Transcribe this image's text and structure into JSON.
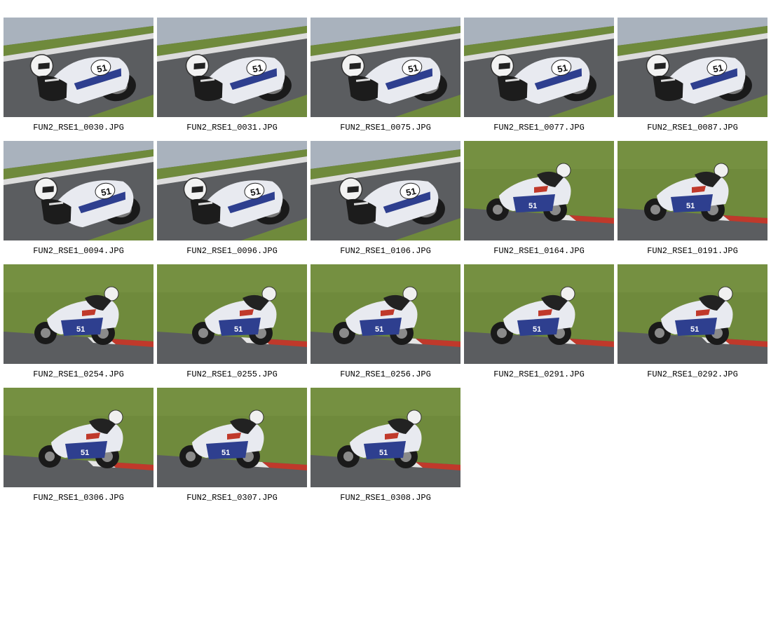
{
  "gallery": {
    "items": [
      {
        "filename": "FUN2_RSE1_0030.JPG",
        "scene": "curve-closeup",
        "number": "51"
      },
      {
        "filename": "FUN2_RSE1_0031.JPG",
        "scene": "curve-closeup",
        "number": "51"
      },
      {
        "filename": "FUN2_RSE1_0075.JPG",
        "scene": "curve-closeup",
        "number": "51"
      },
      {
        "filename": "FUN2_RSE1_0077.JPG",
        "scene": "curve-closeup",
        "number": "51"
      },
      {
        "filename": "FUN2_RSE1_0087.JPG",
        "scene": "curve-closeup",
        "number": "51"
      },
      {
        "filename": "FUN2_RSE1_0094.JPG",
        "scene": "curve-closeup",
        "number": "51"
      },
      {
        "filename": "FUN2_RSE1_0096.JPG",
        "scene": "curve-closeup",
        "number": "51"
      },
      {
        "filename": "FUN2_RSE1_0106.JPG",
        "scene": "curve-closeup",
        "number": "51"
      },
      {
        "filename": "FUN2_RSE1_0164.JPG",
        "scene": "grass-lean",
        "number": "51"
      },
      {
        "filename": "FUN2_RSE1_0191.JPG",
        "scene": "grass-lean",
        "number": "51"
      },
      {
        "filename": "FUN2_RSE1_0254.JPG",
        "scene": "grass-lean",
        "number": "51"
      },
      {
        "filename": "FUN2_RSE1_0255.JPG",
        "scene": "grass-lean",
        "number": "51"
      },
      {
        "filename": "FUN2_RSE1_0256.JPG",
        "scene": "grass-lean",
        "number": "51"
      },
      {
        "filename": "FUN2_RSE1_0291.JPG",
        "scene": "grass-lean",
        "number": "51"
      },
      {
        "filename": "FUN2_RSE1_0292.JPG",
        "scene": "grass-lean",
        "number": "51"
      },
      {
        "filename": "FUN2_RSE1_0306.JPG",
        "scene": "grass-lean",
        "number": "51"
      },
      {
        "filename": "FUN2_RSE1_0307.JPG",
        "scene": "grass-lean",
        "number": "51"
      },
      {
        "filename": "FUN2_RSE1_0308.JPG",
        "scene": "grass-lean",
        "number": "51"
      }
    ]
  },
  "colors": {
    "background": "#ffffff",
    "grass": "#6f8a3c",
    "asphalt": "#5b5d60",
    "barrier": "#a9b2bd",
    "bike_white": "#e8eaf0",
    "bike_blue": "#2e3f8f",
    "curb_red": "#c0392b"
  }
}
